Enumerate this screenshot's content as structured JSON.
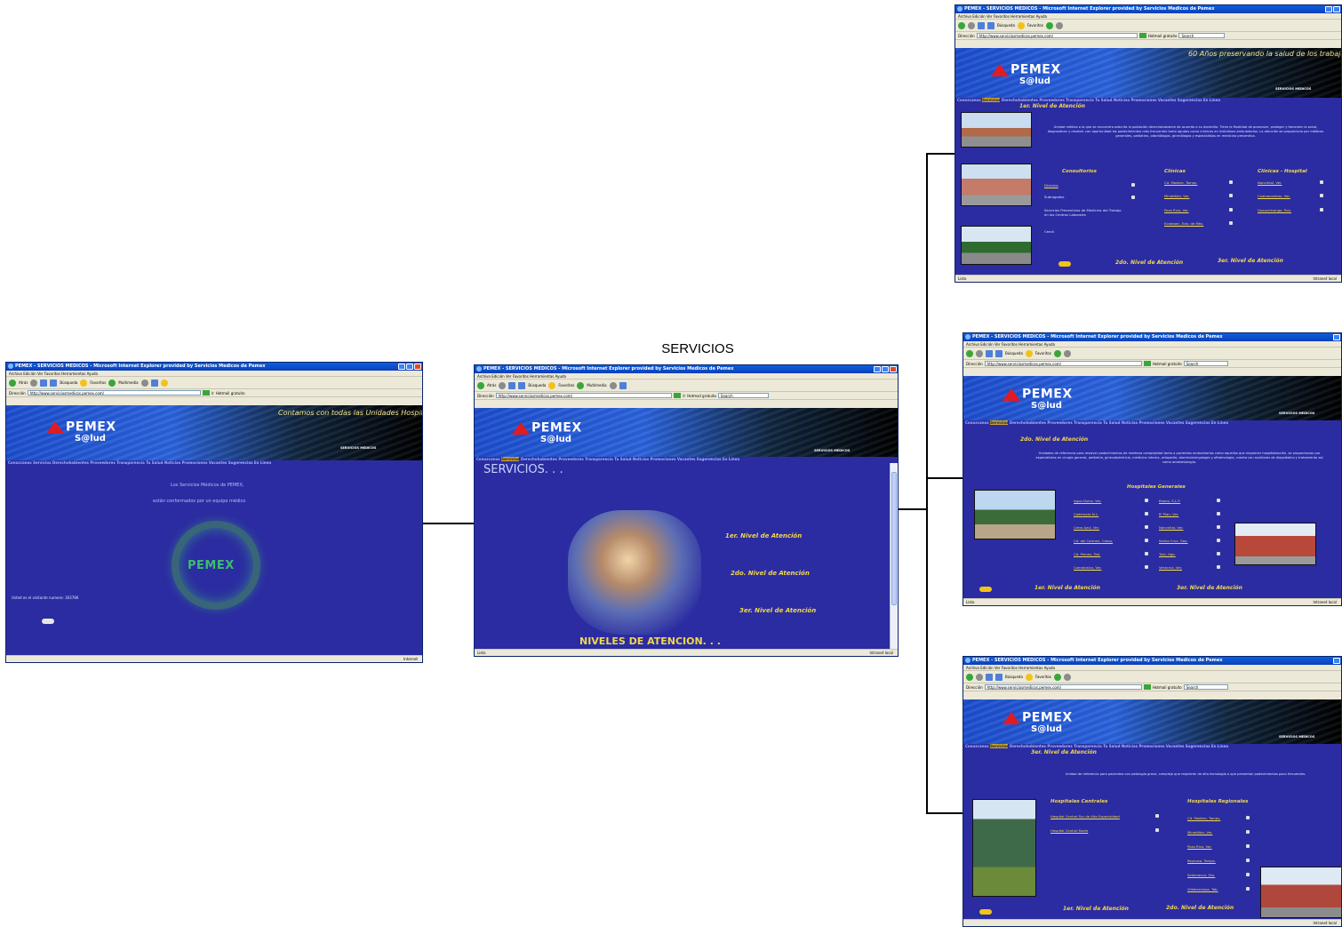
{
  "diagram": {
    "title": "SERVICIOS"
  },
  "browser": {
    "title": "PEMEX - SERVICIOS MEDICOS - Microsoft Internet Explorer provided by Servicios Medicos de Pemex",
    "menu": "Archivo   Edición   Ver   Favoritos   Herramientas   Ayuda",
    "back_label": "Atrás",
    "search_label": "Búsqueda",
    "favorites_label": "Favoritos",
    "multimedia_label": "Multimedia",
    "address_label": "Dirección",
    "address_url": "http://www.serviciosmedicos.pemex.com/",
    "go_label": "Ir",
    "hotmail_label": "Hotmail gratuito",
    "search_box": "Search",
    "status_done": "Listo",
    "zone_internet": "Internet",
    "zone_intranet": "Intranet local"
  },
  "site": {
    "logo_text": "PEMEX",
    "logo_sub": "S@lud",
    "servicios_medicos": "SERVICIOS MEDICOS",
    "nav_items": [
      "Conozcanos",
      "Servicios",
      "Derechohabientes",
      "Proveedores",
      "Transparencia",
      "Tu Salud",
      "Noticias",
      "Promociones",
      "Vacantes",
      "Sugerencias",
      "En Línea"
    ]
  },
  "home_page": {
    "marquee": "Contamos con todas las Unidades Hospitalarias Cer",
    "welcome_line1": "Los Servicios Médicos de PEMEX,",
    "welcome_line2": "están conformados por un equipo médico",
    "visitor_text": "Usted es el visitante numero: 303786",
    "ring_logo": "PEMEX"
  },
  "servicios_page": {
    "heading": "SERVICIOS. . .",
    "link_1": "1er. Nivel de Atención",
    "link_2": "2do. Nivel de Atención",
    "link_3": "3er. Nivel de Atención",
    "caption": "NIVELES DE ATENCION. . ."
  },
  "nivel1_page": {
    "marquee": "60 Años preservando la salud de los trabajadores de la",
    "heading": "1er. Nivel de Atención",
    "paragraph": "Unidad médica a la que se encuentra adscrita la población derechohabiente de acuerdo a su domicilio. Tiene la finalidad de promover, proteger y fomentar la salud, diagnosticar y resolver con oportunidad los padecimientos más frecuentes tanto agudos como crónicos en individuos ambulatorios. La atención se proporciona por médicos generales, pediatras, odontólogos, ginecólogos y especialistas en medicina preventiva.",
    "col_consultorios": "Consultorios",
    "col_clinicas": "Clínicas",
    "col_clinicas_hospital": "Clínicas - Hospital",
    "consultorios": [
      "Directos",
      "Subrogados"
    ],
    "consultorios_extra": "Servicios Preventivos de Medicina del Trabajo en los Centros Laborales",
    "cendi": "Cendi",
    "clinicas": [
      "Cd. Madero, Tamps.",
      "Minatitlán, Ver.",
      "Poza Rica, Ver.",
      "Ecatepec, Edo. de Méx."
    ],
    "clinicas_hospital": [
      "Nanchital, Ver.",
      "Coatzacoalcos, Ver.",
      "Huauchinango, Pue."
    ],
    "footer_2": "2do. Nivel de Atención",
    "footer_3": "3er. Nivel de Atención"
  },
  "nivel2_page": {
    "heading": "2do. Nivel de Atención",
    "paragraph": "Unidades de referencia para resolver padecimientos de mediana complejidad tanto a pacientes ambulatorios como aquellos que requieren hospitalización, se proporcionan por especialistas en cirugía general, pediatría, ginecobstetricia, medicina interna, ortopedia, otorrinolaringología y oftalmología, cuenta con auxiliares de diagnóstico y tratamiento así como anestesiología.",
    "col_hospitales": "Hospitales Generales",
    "hospitales_a": [
      "Agua Dulce, Ver.",
      "Cadereyta N.L.",
      "Cerro Azul, Ver.",
      "Cd. del Carmen, Camp.",
      "Cd. Pemex, Tab.",
      "Comalcalco, Ver."
    ],
    "hospitales_b": [
      "Ebano, S.L.P.",
      "El Plan, Ver.",
      "Nanchital, Ver.",
      "Salina Cruz, Oax.",
      "Tula, Hgo.",
      "Veracruz, Ver."
    ],
    "footer_1": "1er. Nivel de Atención",
    "footer_3": "3er. Nivel de Atención"
  },
  "nivel3_page": {
    "heading": "3er. Nivel de Atención",
    "paragraph": "Unidad de referencia para pacientes con patología grave, compleja que requieren de alta tecnología o que presentan padecimientos poco frecuentes.",
    "col_centrales": "Hospitales Centrales",
    "col_regionales": "Hospitales Regionales",
    "centrales": [
      "Hospital Central Sur de Alta Especialidad",
      "Hospital Central Norte"
    ],
    "regionales": [
      "Cd. Madero, Tamps.",
      "Minatitlán, Ver.",
      "Poza Rica, Ver.",
      "Reynosa, Tamps.",
      "Salamanca, Gto.",
      "Villahermosa, Tab."
    ],
    "footer_1": "1er. Nivel de Atención",
    "footer_2": "2do. Nivel de Atención"
  },
  "colors": {
    "page_bg": "#2b2ca1",
    "accent_link": "#f2d74c",
    "pemex_red": "#e11b22"
  }
}
